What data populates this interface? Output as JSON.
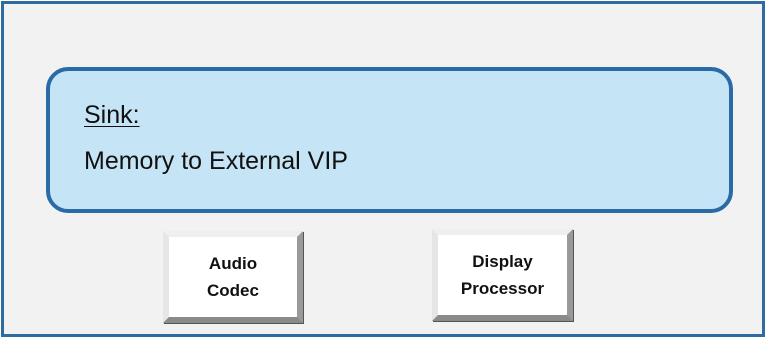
{
  "sink": {
    "label": "Sink:",
    "value": "Memory to External VIP"
  },
  "nodes": [
    {
      "line1": "Audio",
      "line2": "Codec"
    },
    {
      "line1": "Display",
      "line2": "Processor"
    }
  ],
  "colors": {
    "frame_border": "#2d6ba1",
    "frame_fill": "#f2f2f2",
    "sink_fill": "#c5e5f6",
    "sink_border": "#2a6aa6",
    "node_fill": "#ffffff"
  }
}
